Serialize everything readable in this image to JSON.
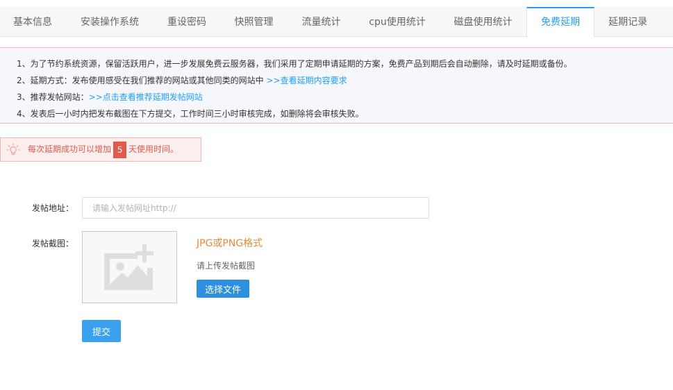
{
  "tabs": [
    {
      "label": "基本信息"
    },
    {
      "label": "安装操作系统"
    },
    {
      "label": "重设密码"
    },
    {
      "label": "快照管理"
    },
    {
      "label": "流量统计"
    },
    {
      "label": "cpu使用统计"
    },
    {
      "label": "磁盘使用统计"
    },
    {
      "label": "免费延期",
      "active": true
    },
    {
      "label": "延期记录"
    }
  ],
  "notice": {
    "line1": "1、为了节约系统资源，保留活跃用户，进一步发展免费云服务器，我们采用了定期申请延期的方案，免费产品到期后会自动删除，请及时延期或备份。",
    "line2_text": "2、延期方式：发布使用感受在我们推荐的网站或其他同类的网站中 ",
    "line2_link": ">>查看延期内容要求",
    "line3_text": "3、推荐发帖网站：",
    "line3_link": ">>点击查看推荐延期发帖网站",
    "line4": "4、发表后一小时内把发布截图在下方提交，工作时间三小时审核完成，如删除将会审核失败。"
  },
  "tip": {
    "prefix": "每次延期成功可以增加",
    "days": "5",
    "suffix": "天使用时间。"
  },
  "form": {
    "url_label": "发帖地址：",
    "url_placeholder": "请输入发帖网址http://",
    "url_value": "",
    "screenshot_label": "发帖截图：",
    "format_text": "JPG或PNG格式",
    "upload_hint": "请上传发帖截图",
    "choose_file_label": "选择文件",
    "submit_label": "提交"
  },
  "colors": {
    "accent": "#1e9fff",
    "warning": "#e05a4e",
    "format": "#e6893a",
    "button": "#2d8fe0"
  },
  "icons": {
    "tip": "lightbulb-icon",
    "upload": "image-add-icon"
  }
}
